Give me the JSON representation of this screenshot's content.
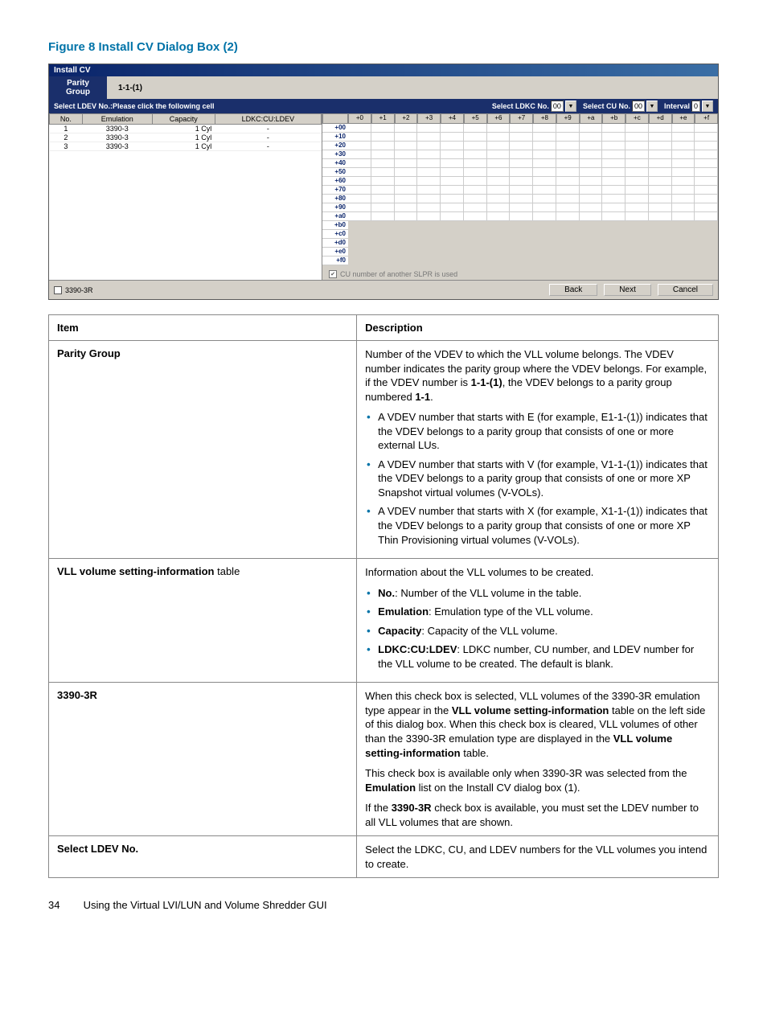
{
  "figure_title": "Figure 8 Install CV Dialog Box (2)",
  "dialog": {
    "title": "Install CV",
    "parity_group_label": "Parity Group",
    "parity_group_value": "1-1-(1)",
    "prompt_left": "Select LDEV No.:Please click the following cell",
    "select_ldkc_label": "Select LDKC No.",
    "select_ldkc_value": "00",
    "select_cu_label": "Select CU No.",
    "select_cu_value": "00",
    "interval_label": "Interval",
    "interval_value": "0",
    "left_headers": [
      "No.",
      "Emulation",
      "Capacity",
      "LDKC:CU:LDEV"
    ],
    "left_rows": [
      {
        "no": "1",
        "emu": "3390-3",
        "cap": "1 Cyl",
        "ldev": "-"
      },
      {
        "no": "2",
        "emu": "3390-3",
        "cap": "1 Cyl",
        "ldev": "-"
      },
      {
        "no": "3",
        "emu": "3390-3",
        "cap": "1 Cyl",
        "ldev": "-"
      }
    ],
    "col_headers": [
      "+0",
      "+1",
      "+2",
      "+3",
      "+4",
      "+5",
      "+6",
      "+7",
      "+8",
      "+9",
      "+a",
      "+b",
      "+c",
      "+d",
      "+e",
      "+f"
    ],
    "row_headers": [
      "+00",
      "+10",
      "+20",
      "+30",
      "+40",
      "+50",
      "+60",
      "+70",
      "+80",
      "+90",
      "+a0",
      "+b0",
      "+c0",
      "+d0",
      "+e0",
      "+f0"
    ],
    "note": "CU number of another SLPR is used",
    "cb_3390": "3390-3R",
    "btn_back": "Back",
    "btn_next": "Next",
    "btn_cancel": "Cancel"
  },
  "table": {
    "headers": {
      "item": "Item",
      "desc": "Description"
    },
    "rows": [
      {
        "item_html": "<b>Parity Group</b>",
        "desc_paras": [
          "Number of the VDEV to which the VLL volume belongs. The VDEV number indicates the parity group where the VDEV belongs. For example, if the VDEV number is <b>1-1-(1)</b>, the VDEV belongs to a parity group numbered <b>1-1</b>."
        ],
        "bullets": [
          "A VDEV number that starts with E (for example, E1-1-(1)) indicates that the VDEV belongs to a parity group that consists of one or more external LUs.",
          "A VDEV number that starts with V (for example, V1-1-(1)) indicates that the VDEV belongs to a parity group that consists of one or more XP Snapshot virtual volumes (V-VOLs).",
          "A VDEV number that starts with X (for example, X1-1-(1)) indicates that the VDEV belongs to a parity group that consists of one or more XP Thin Provisioning virtual volumes (V-VOLs)."
        ]
      },
      {
        "item_html": "<b>VLL volume setting-information</b> table",
        "desc_paras": [
          "Information about the VLL volumes to be created."
        ],
        "bullets": [
          "<b>No.</b>: Number of the VLL volume in the table.",
          "<b>Emulation</b>: Emulation type of the VLL volume.",
          "<b>Capacity</b>: Capacity of the VLL volume.",
          "<b>LDKC:CU:LDEV</b>: LDKC number, CU number, and LDEV number for the VLL volume to be created. The default is blank."
        ]
      },
      {
        "item_html": "<b>3390-3R</b>",
        "desc_paras": [
          "When this check box is selected, VLL volumes of the 3390-3R emulation type appear in the <b>VLL volume setting-information</b> table on the left side of this dialog box. When this check box is cleared, VLL volumes of other than the 3390-3R emulation type are displayed in the <b>VLL volume setting-information</b> table.",
          "This check box is available only when 3390-3R was selected from the <b>Emulation</b> list on the Install CV dialog box (1).",
          "If the <b>3390-3R</b> check box is available, you must set the LDEV number to all VLL volumes that are shown."
        ],
        "bullets": []
      },
      {
        "item_html": "<b>Select LDEV No.</b>",
        "desc_paras": [
          "Select the LDKC, CU, and LDEV numbers for the VLL volumes you intend to create."
        ],
        "bullets": []
      }
    ]
  },
  "footer": {
    "page_no": "34",
    "chapter": "Using the Virtual LVI/LUN and Volume Shredder GUI"
  }
}
